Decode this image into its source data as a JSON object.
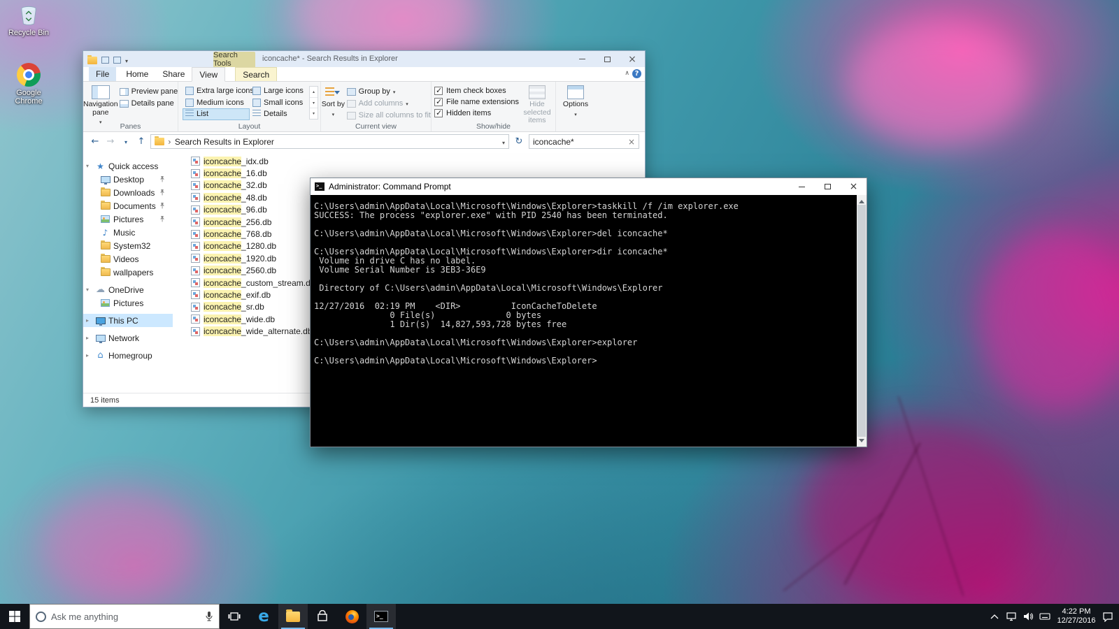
{
  "colors": {
    "accent_blue": "#0078d7",
    "search_highlight": "#fbf3b0",
    "selection_blue": "#cce8ff",
    "taskbar": "#11151b"
  },
  "desktop_icons": [
    {
      "label": "Recycle Bin"
    },
    {
      "label": "Google Chrome"
    }
  ],
  "explorer": {
    "title": "iconcache* - Search Results in Explorer",
    "search_tools": "Search Tools",
    "tabs": {
      "file": "File",
      "home": "Home",
      "share": "Share",
      "view": "View",
      "search": "Search"
    },
    "ribbon": {
      "navigation_pane": "Navigation pane",
      "preview_pane": "Preview pane",
      "details_pane": "Details pane",
      "group_panes": "Panes",
      "layout": [
        "Extra large icons",
        "Large icons",
        "Medium icons",
        "Small icons",
        "List",
        "Details"
      ],
      "group_layout": "Layout",
      "sort_by": "Sort by",
      "group_by": "Group by",
      "add_columns": "Add columns",
      "size_all_columns": "Size all columns to fit",
      "group_current_view": "Current view",
      "item_check_boxes": "Item check boxes",
      "file_name_extensions": "File name extensions",
      "hidden_items": "Hidden items",
      "hide_selected_items": "Hide selected items",
      "options": "Options",
      "group_show_hide": "Show/hide"
    },
    "nav": {
      "address": "Search Results in Explorer",
      "search": "iconcache*"
    },
    "sidebar": [
      {
        "label": "Quick access"
      },
      {
        "label": "Desktop"
      },
      {
        "label": "Downloads"
      },
      {
        "label": "Documents"
      },
      {
        "label": "Pictures"
      },
      {
        "label": "Music"
      },
      {
        "label": "System32"
      },
      {
        "label": "Videos"
      },
      {
        "label": "wallpapers"
      },
      {
        "label": "OneDrive"
      },
      {
        "label": "Pictures"
      },
      {
        "label": "This PC"
      },
      {
        "label": "Network"
      },
      {
        "label": "Homegroup"
      }
    ],
    "files": [
      {
        "hl": "iconcache",
        "rest": "_idx.db"
      },
      {
        "hl": "iconcache",
        "rest": "_16.db"
      },
      {
        "hl": "iconcache",
        "rest": "_32.db"
      },
      {
        "hl": "iconcache",
        "rest": "_48.db"
      },
      {
        "hl": "iconcache",
        "rest": "_96.db"
      },
      {
        "hl": "iconcache",
        "rest": "_256.db"
      },
      {
        "hl": "iconcache",
        "rest": "_768.db"
      },
      {
        "hl": "iconcache",
        "rest": "_1280.db"
      },
      {
        "hl": "iconcache",
        "rest": "_1920.db"
      },
      {
        "hl": "iconcache",
        "rest": "_2560.db"
      },
      {
        "hl": "iconcache",
        "rest": "_custom_stream.db"
      },
      {
        "hl": "iconcache",
        "rest": "_exif.db"
      },
      {
        "hl": "iconcache",
        "rest": "_sr.db"
      },
      {
        "hl": "iconcache",
        "rest": "_wide.db"
      },
      {
        "hl": "iconcache",
        "rest": "_wide_alternate.db"
      }
    ],
    "status": "15 items"
  },
  "cmd": {
    "title": "Administrator: Command Prompt",
    "lines": [
      "C:\\Users\\admin\\AppData\\Local\\Microsoft\\Windows\\Explorer>taskkill /f /im explorer.exe",
      "SUCCESS: The process \"explorer.exe\" with PID 2540 has been terminated.",
      "",
      "C:\\Users\\admin\\AppData\\Local\\Microsoft\\Windows\\Explorer>del iconcache*",
      "",
      "C:\\Users\\admin\\AppData\\Local\\Microsoft\\Windows\\Explorer>dir iconcache*",
      " Volume in drive C has no label.",
      " Volume Serial Number is 3EB3-36E9",
      "",
      " Directory of C:\\Users\\admin\\AppData\\Local\\Microsoft\\Windows\\Explorer",
      "",
      "12/27/2016  02:19 PM    <DIR>          IconCacheToDelete",
      "               0 File(s)              0 bytes",
      "               1 Dir(s)  14,827,593,728 bytes free",
      "",
      "C:\\Users\\admin\\AppData\\Local\\Microsoft\\Windows\\Explorer>explorer",
      "",
      "C:\\Users\\admin\\AppData\\Local\\Microsoft\\Windows\\Explorer>"
    ]
  },
  "taskbar": {
    "search_placeholder": "Ask me anything",
    "clock": {
      "time": "4:22 PM",
      "date": "12/27/2016"
    }
  }
}
